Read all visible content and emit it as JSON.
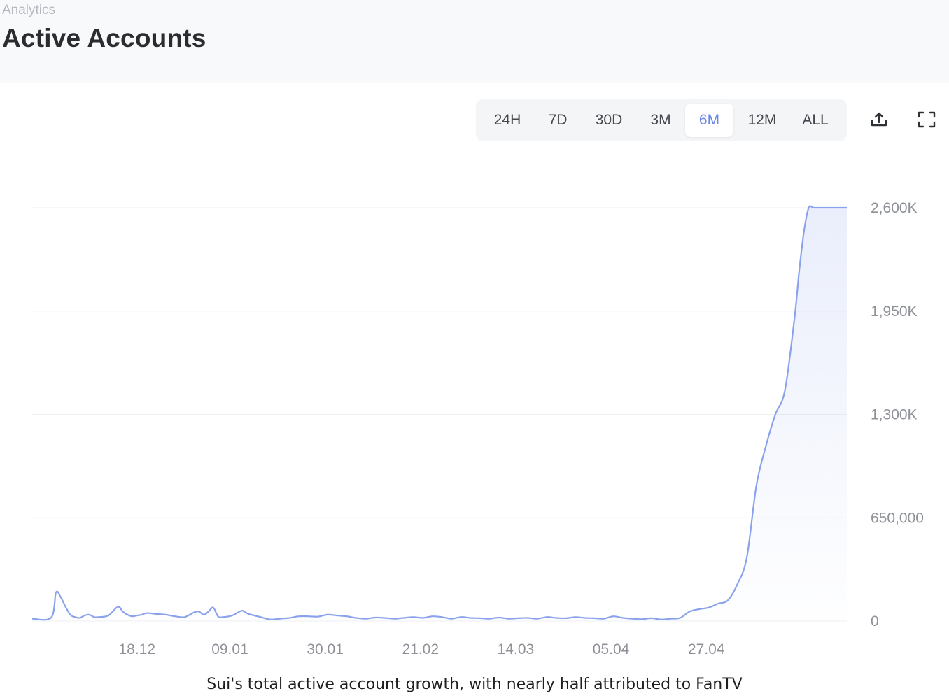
{
  "header": {
    "breadcrumb": "Analytics",
    "title": "Active Accounts"
  },
  "toolbar": {
    "ranges": [
      "24H",
      "7D",
      "30D",
      "3M",
      "6M",
      "12M",
      "ALL"
    ],
    "selected_range": "6M",
    "share_icon": "upload-share-icon",
    "fullscreen_icon": "fullscreen-expand-icon"
  },
  "colors": {
    "line": "#8aa2ec",
    "accent": "#6b86ec",
    "grid": "#eef0f3",
    "tick_text": "#8e9198"
  },
  "chart_data": {
    "type": "area",
    "title": "",
    "xlabel": "",
    "ylabel": "",
    "x_ticks": [
      "18.12",
      "09.01",
      "30.01",
      "21.02",
      "14.03",
      "05.04",
      "27.04"
    ],
    "y_ticks": [
      "0",
      "650,000",
      "1,300K",
      "1,950K",
      "2,600K"
    ],
    "ylim": [
      0,
      2600000
    ],
    "xlim": [
      0,
      171
    ],
    "x_tick_positions": [
      22,
      41.5,
      61.5,
      81.5,
      101.5,
      121.5,
      141.5
    ],
    "grid": true,
    "legend": "none",
    "series": [
      {
        "x": [
          0,
          4,
          5,
          6,
          7,
          8,
          9,
          10,
          11,
          12,
          13,
          14,
          16,
          18,
          19,
          20,
          21,
          22,
          23,
          24,
          26,
          28,
          30,
          32,
          34,
          35,
          36,
          37,
          38,
          39,
          40,
          42,
          44,
          45,
          46,
          48,
          50,
          52,
          54,
          56,
          58,
          60,
          62,
          64,
          66,
          68,
          70,
          72,
          74,
          76,
          78,
          80,
          82,
          84,
          86,
          88,
          90,
          92,
          94,
          96,
          98,
          100,
          102,
          104,
          106,
          108,
          110,
          112,
          114,
          116,
          118,
          120,
          122,
          124,
          126,
          128,
          130,
          132,
          134,
          136,
          138,
          140,
          142,
          144,
          146,
          148,
          150,
          152,
          154,
          156,
          158,
          160,
          161,
          162,
          163,
          164,
          165,
          166,
          167,
          168,
          169,
          170,
          171
        ],
        "y": [
          15000,
          22000,
          180000,
          150000,
          90000,
          40000,
          25000,
          20000,
          35000,
          40000,
          25000,
          25000,
          35000,
          90000,
          60000,
          40000,
          30000,
          35000,
          40000,
          50000,
          45000,
          40000,
          30000,
          25000,
          55000,
          60000,
          40000,
          60000,
          85000,
          30000,
          25000,
          35000,
          65000,
          50000,
          40000,
          25000,
          10000,
          15000,
          20000,
          30000,
          30000,
          28000,
          40000,
          35000,
          30000,
          20000,
          15000,
          22000,
          20000,
          15000,
          20000,
          25000,
          20000,
          30000,
          25000,
          15000,
          25000,
          20000,
          18000,
          15000,
          22000,
          15000,
          18000,
          20000,
          15000,
          25000,
          20000,
          18000,
          25000,
          20000,
          18000,
          15000,
          30000,
          20000,
          15000,
          12000,
          18000,
          10000,
          15000,
          20000,
          60000,
          75000,
          85000,
          110000,
          130000,
          230000,
          400000,
          850000,
          1100000,
          1300000,
          1450000,
          1900000,
          2200000,
          2450000,
          2600000,
          2600000,
          2600000,
          2600000,
          2600000,
          2600000,
          2600000,
          2600000,
          2600000
        ]
      }
    ]
  },
  "caption": "Sui's total active account growth, with nearly half attributed to FanTV"
}
